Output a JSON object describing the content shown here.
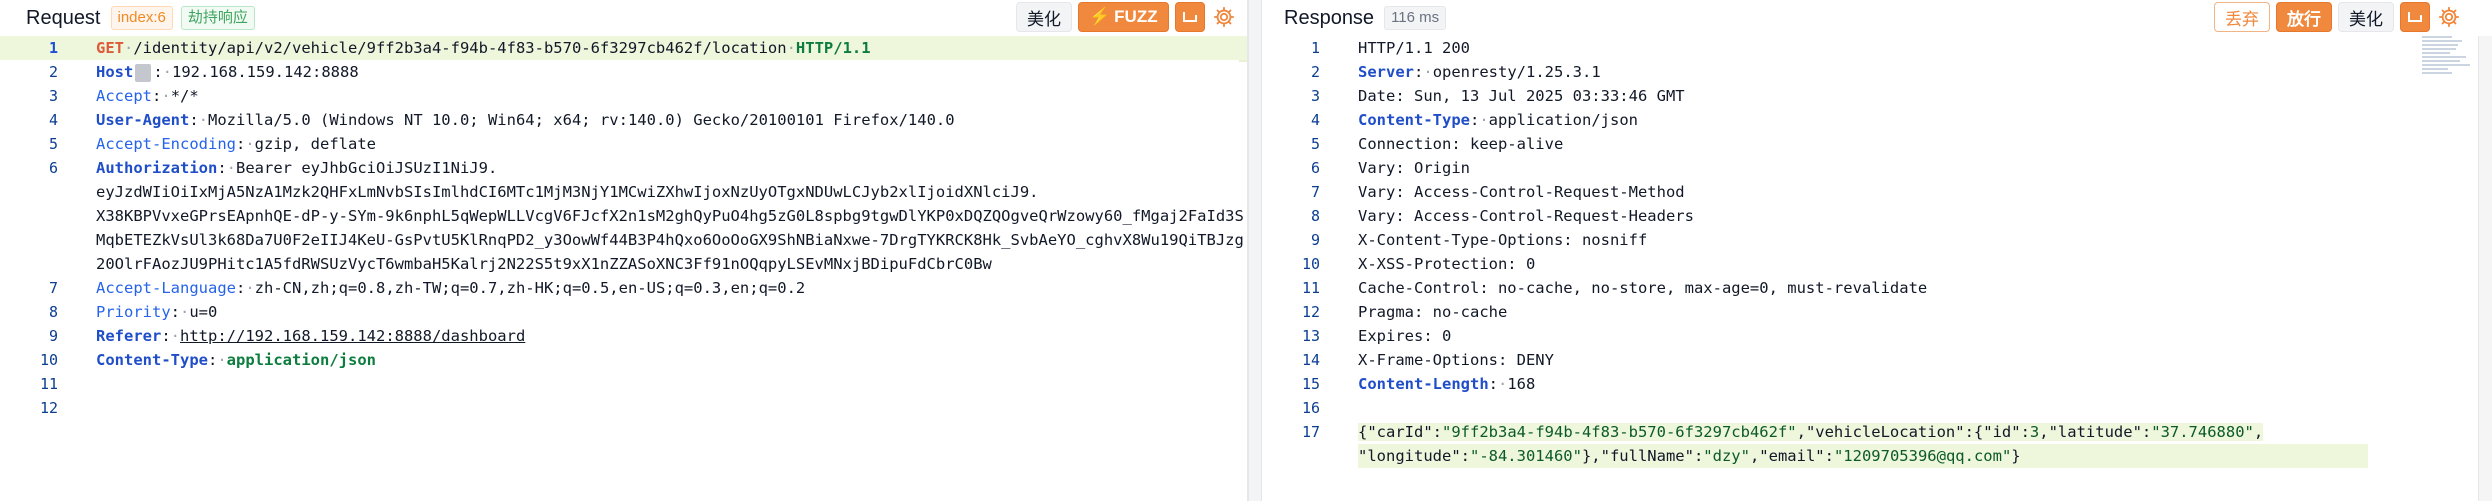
{
  "request": {
    "title": "Request",
    "index_tag": "index:6",
    "hijack_tag": "劫持响应",
    "beautify_label": "美化",
    "fuzz_label": "FUZZ",
    "lines": [
      {
        "n": "1"
      },
      {
        "n": "2"
      },
      {
        "n": "3"
      },
      {
        "n": "4"
      },
      {
        "n": "5"
      },
      {
        "n": "6"
      },
      {
        "n": "7"
      },
      {
        "n": "8"
      },
      {
        "n": "9"
      },
      {
        "n": "10"
      },
      {
        "n": "11"
      },
      {
        "n": "12"
      }
    ],
    "method": "GET",
    "path": "/identity/api/v2/vehicle/9ff2b3a4-f94b-4f83-b570-6f3297cb462f/location",
    "protocol": "HTTP/1.1",
    "headers": {
      "host_key": "Host",
      "host_val": "192.168.159.142:8888",
      "accept_key": "Accept",
      "accept_val": "*/*",
      "ua_key": "User-Agent",
      "ua_val": "Mozilla/5.0 (Windows NT 10.0; Win64; x64; rv:140.0) Gecko/20100101 Firefox/140.0",
      "enc_key": "Accept-Encoding",
      "enc_val": "gzip, deflate",
      "auth_key": "Authorization",
      "auth_val": "Bearer eyJhbGciOiJSUzI1NiJ9.",
      "auth_cont1": "eyJzdWIiOiIxMjA5NzA1Mzk2QHFxLmNvbSIsImlhdCI6MTc1MjM3NjY1MCwiZXhwIjoxNzUyOTgxNDUwLCJyb2xlIjoidXNlciJ9.",
      "auth_cont2": "X38KBPVvxeGPrsEApnhQE-dP-y-SYm-9k6nphL5qWepWLLVcgV6FJcfX2n1sM2ghQyPuO4hg5zG0L8spbg9tgwDlYKP0xDQZQOgveQrWzowy60_fMgaj2FaId3SMqbETEZkVsUl3k68Da7U0F2eIIJ4KeU-GsPvtU5KlRnqPD2_y3OowWf44B3P4hQxo6OoOoGX9ShNBiaNxwe-7DrgTYKRCK8Hk_SvbAeYO_cghvX8Wu19QiTBJzg20OlrFAozJU9PHitc1A5fdRWSUzVycT6wmbaH5Kalrj2N22S5t9xX1nZZASoXNC3Ff91nOQqpyLSEvMNxjBDipuFdCbrC0Bw",
      "lang_key": "Accept-Language",
      "lang_val": "zh-CN,zh;q=0.8,zh-TW;q=0.7,zh-HK;q=0.5,en-US;q=0.3,en;q=0.2",
      "prio_key": "Priority",
      "prio_val": "u=0",
      "ref_key": "Referer",
      "ref_val": "http://192.168.159.142:8888/dashboard",
      "ct_key": "Content-Type",
      "ct_val": "application/json"
    }
  },
  "response": {
    "title": "Response",
    "time_tag": "116 ms",
    "discard_label": "丢弃",
    "release_label": "放行",
    "beautify_label": "美化",
    "lines": [
      {
        "n": "1"
      },
      {
        "n": "2"
      },
      {
        "n": "3"
      },
      {
        "n": "4"
      },
      {
        "n": "5"
      },
      {
        "n": "6"
      },
      {
        "n": "7"
      },
      {
        "n": "8"
      },
      {
        "n": "9"
      },
      {
        "n": "10"
      },
      {
        "n": "11"
      },
      {
        "n": "12"
      },
      {
        "n": "13"
      },
      {
        "n": "14"
      },
      {
        "n": "15"
      },
      {
        "n": "16"
      },
      {
        "n": "17"
      }
    ],
    "status_line": "HTTP/1.1 200",
    "server_key": "Server",
    "server_val": "openresty/1.25.3.1",
    "date_line": "Date: Sun, 13 Jul 2025 03:33:46 GMT",
    "ct_key": "Content-Type",
    "ct_val": "application/json",
    "conn_line": "Connection: keep-alive",
    "vary1": "Vary: Origin",
    "vary2": "Vary: Access-Control-Request-Method",
    "vary3": "Vary: Access-Control-Request-Headers",
    "xcto": "X-Content-Type-Options: nosniff",
    "xxss": "X-XSS-Protection: 0",
    "cache": "Cache-Control: no-cache, no-store, max-age=0, must-revalidate",
    "pragma": "Pragma: no-cache",
    "expires": "Expires: 0",
    "xfo": "X-Frame-Options: DENY",
    "cl_key": "Content-Length",
    "cl_val": "168",
    "body": {
      "p1": "{\"carId\":",
      "carId": "\"9ff2b3a4-f94b-4f83-b570-6f3297cb462f\"",
      "p2": ",\"vehicleLocation\":{\"id\":",
      "id": "3",
      "p3": ",\"latitude\":",
      "latitude": "\"37.746880\"",
      "p4": ",",
      "p5": "\"longitude\":",
      "longitude": "\"-84.301460\"",
      "p6": "},\"fullName\":",
      "fullName": "\"dzy\"",
      "p7": ",\"email\":",
      "email": "\"1209705396@qq.com\"",
      "p8": "}"
    }
  },
  "colors": {
    "accent_orange": "#f0883e",
    "line_highlight": "#eef6dc",
    "header_key_blue": "#1f4ec8"
  },
  "icons": {
    "fuzz": "lightning-icon",
    "enter": "return-icon",
    "settings": "gear-icon"
  }
}
